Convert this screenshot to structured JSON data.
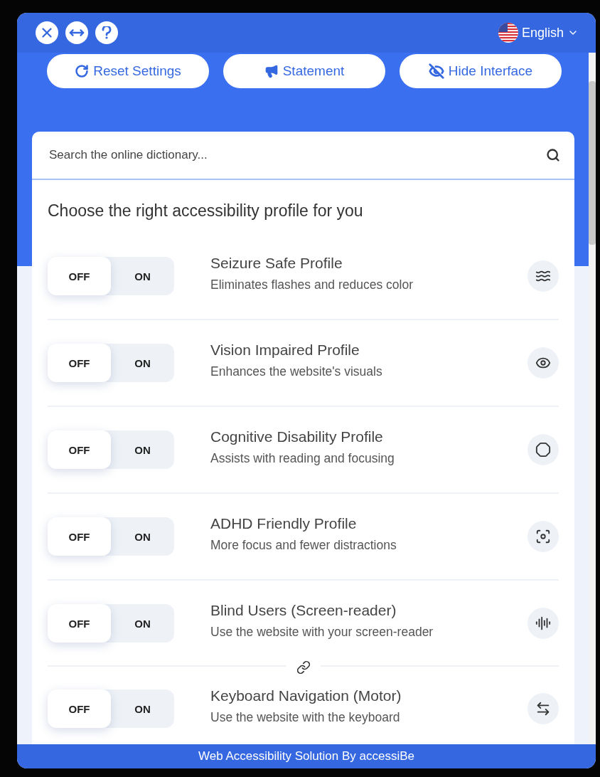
{
  "header": {
    "language": "English"
  },
  "actions": [
    {
      "kind": "reset",
      "label": "Reset Settings"
    },
    {
      "kind": "statement",
      "label": "Statement"
    },
    {
      "kind": "hide",
      "label": "Hide Interface"
    }
  ],
  "search": {
    "placeholder": "Search the online dictionary..."
  },
  "profiles_heading": "Choose the right accessibility profile for you",
  "profiles": [
    {
      "kind": "seizure",
      "title": "Seizure Safe Profile",
      "description": "Eliminates flashes and reduces color",
      "off_label": "OFF",
      "on_label": "ON",
      "on": false
    },
    {
      "kind": "vision",
      "title": "Vision Impaired Profile",
      "description": "Enhances the website's visuals",
      "off_label": "OFF",
      "on_label": "ON",
      "on": false
    },
    {
      "kind": "cognitive",
      "title": "Cognitive Disability Profile",
      "description": "Assists with reading and focusing",
      "off_label": "OFF",
      "on_label": "ON",
      "on": false
    },
    {
      "kind": "adhd",
      "title": "ADHD Friendly Profile",
      "description": "More focus and fewer distractions",
      "off_label": "OFF",
      "on_label": "ON",
      "on": false
    },
    {
      "kind": "blind",
      "title": "Blind Users (Screen-reader)",
      "description": "Use the website with your screen-reader",
      "off_label": "OFF",
      "on_label": "ON",
      "on": false
    },
    {
      "kind": "keyboard",
      "title": "Keyboard Navigation (Motor)",
      "description": "Use the website with the keyboard",
      "off_label": "OFF",
      "on_label": "ON",
      "on": false
    }
  ],
  "footer": "Web Accessibility Solution By accessiBe"
}
